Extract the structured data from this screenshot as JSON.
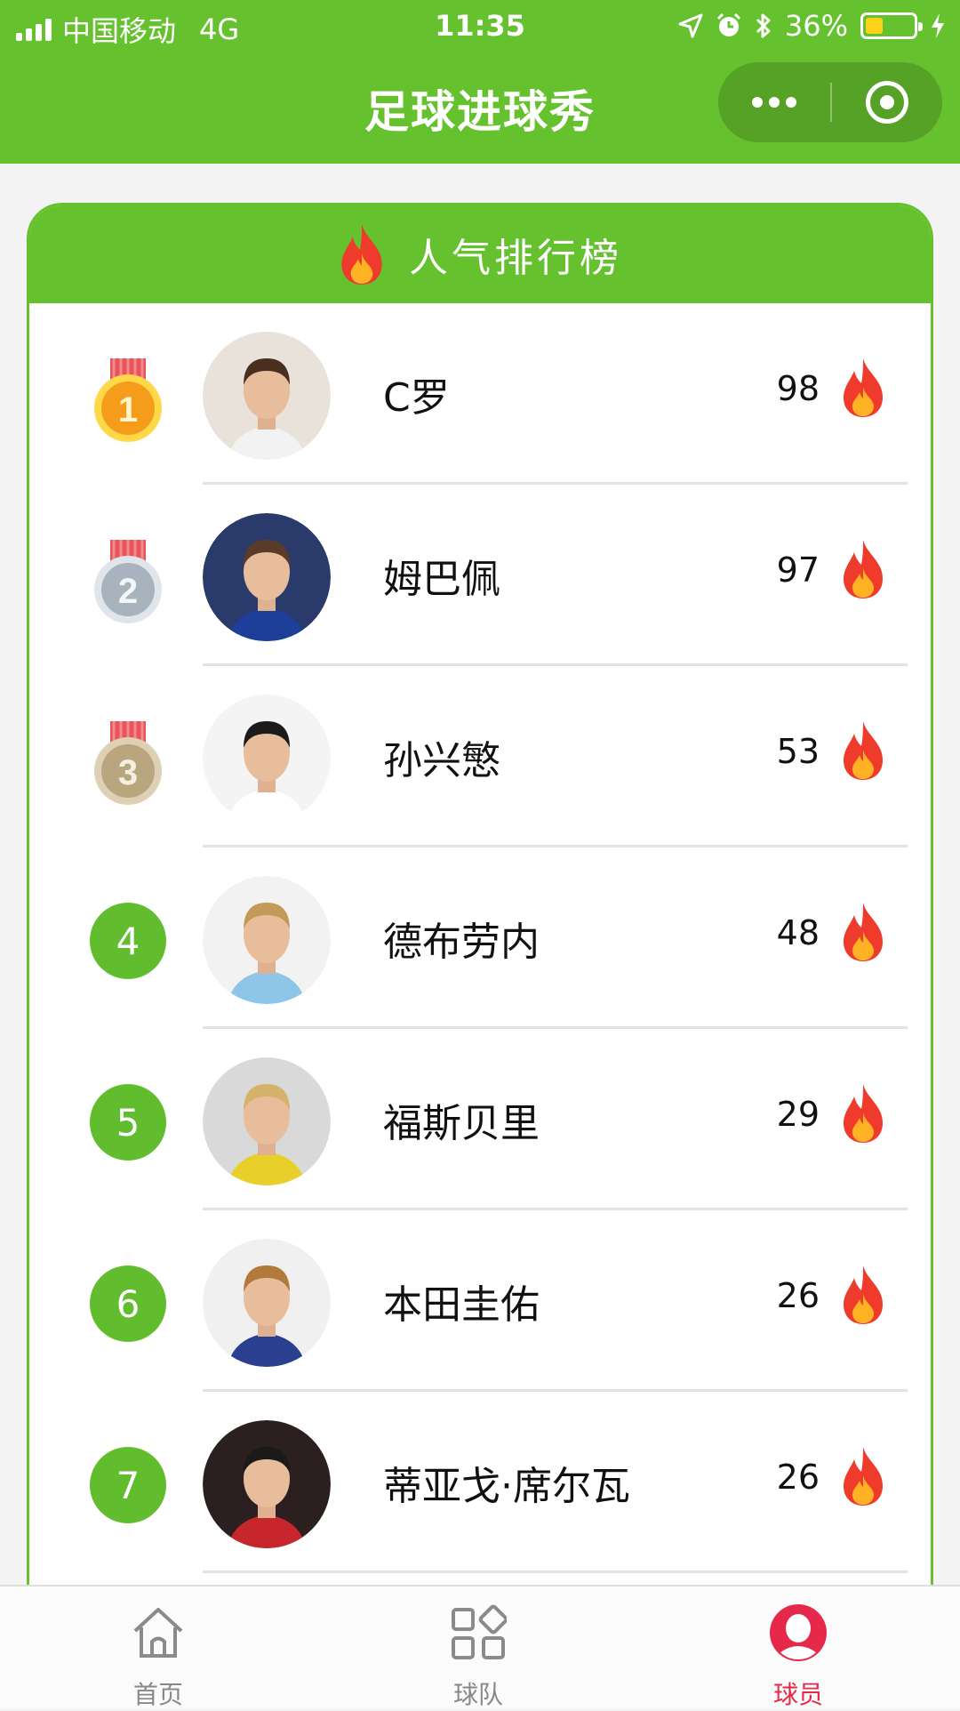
{
  "status_bar": {
    "carrier": "中国移动",
    "network": "4G",
    "time": "11:35",
    "battery": "36%",
    "battery_level": 0.36
  },
  "nav": {
    "title": "足球进球秀"
  },
  "leaderboard": {
    "title": "人气排行榜",
    "players": [
      {
        "rank": "1",
        "name": "C罗",
        "score": "98",
        "badge": "gold-medal"
      },
      {
        "rank": "2",
        "name": "姆巴佩",
        "score": "97",
        "badge": "silver-medal"
      },
      {
        "rank": "3",
        "name": "孙兴慜",
        "score": "53",
        "badge": "bronze-medal"
      },
      {
        "rank": "4",
        "name": "德布劳内",
        "score": "48"
      },
      {
        "rank": "5",
        "name": "福斯贝里",
        "score": "29"
      },
      {
        "rank": "6",
        "name": "本田圭佑",
        "score": "26"
      },
      {
        "rank": "7",
        "name": "蒂亚戈·席尔瓦",
        "score": "26"
      }
    ]
  },
  "tabs": [
    {
      "label": "首页",
      "icon": "home-icon",
      "active": false
    },
    {
      "label": "球队",
      "icon": "grid-icon",
      "active": false
    },
    {
      "label": "球员",
      "icon": "user-icon",
      "active": true
    }
  ],
  "colors": {
    "brand_green": "#66c12f",
    "rank_circle": "#62bd2e",
    "active_tab": "#e6294b",
    "gold": "#f59c1a",
    "silver": "#a9b3bd",
    "bronze": "#b9a57e",
    "flame_outer": "#ee3b2b",
    "flame_inner": "#ffb324"
  }
}
